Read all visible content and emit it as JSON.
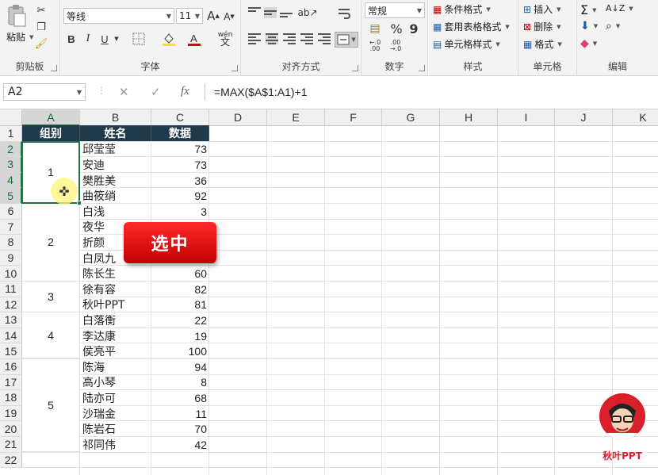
{
  "ribbon": {
    "clipboard": {
      "paste_label": "粘贴",
      "group_label": "剪贴板"
    },
    "font": {
      "font_name": "等线",
      "font_size": "11",
      "group_label": "字体",
      "phonetic_label": "wén"
    },
    "alignment": {
      "group_label": "对齐方式"
    },
    "number": {
      "format": "常规",
      "group_label": "数字",
      "percent": "%",
      "comma": "9"
    },
    "styles": {
      "conditional": "条件格式",
      "table": "套用表格格式",
      "cell_styles": "单元格样式",
      "group_label": "样式"
    },
    "cells": {
      "insert": "插入",
      "delete": "删除",
      "format": "格式",
      "group_label": "单元格"
    },
    "editing": {
      "group_label": "编辑"
    }
  },
  "formula_bar": {
    "name_box": "A2",
    "formula": "=MAX($A$1:A1)+1",
    "fx": "fx"
  },
  "columns": [
    "A",
    "B",
    "C",
    "D",
    "E",
    "F",
    "G",
    "H",
    "I",
    "J",
    "K"
  ],
  "rows": [
    "1",
    "2",
    "3",
    "4",
    "5",
    "6",
    "7",
    "8",
    "9",
    "10",
    "11",
    "12",
    "13",
    "14",
    "15",
    "16",
    "17",
    "18",
    "19",
    "20",
    "21",
    "22"
  ],
  "table": {
    "headers": [
      "组别",
      "姓名",
      "数据"
    ],
    "groups": [
      "1",
      "2",
      "3",
      "4",
      "5"
    ],
    "names": [
      "邱莹莹",
      "安迪",
      "樊胜美",
      "曲筱绡",
      "白浅",
      "夜华",
      "折颜",
      "白凤九",
      "陈长生",
      "徐有容",
      "秋叶PPT",
      "白落衡",
      "李达康",
      "侯亮平",
      "陈海",
      "高小琴",
      "陆亦可",
      "沙瑞金",
      "陈岩石",
      "祁同伟"
    ],
    "values": [
      "73",
      "73",
      "36",
      "92",
      "3",
      "",
      "",
      "",
      "60",
      "82",
      "81",
      "22",
      "19",
      "100",
      "94",
      "8",
      "68",
      "11",
      "70",
      "42"
    ]
  },
  "callout": "选中",
  "logo_text": "秋叶PPT"
}
